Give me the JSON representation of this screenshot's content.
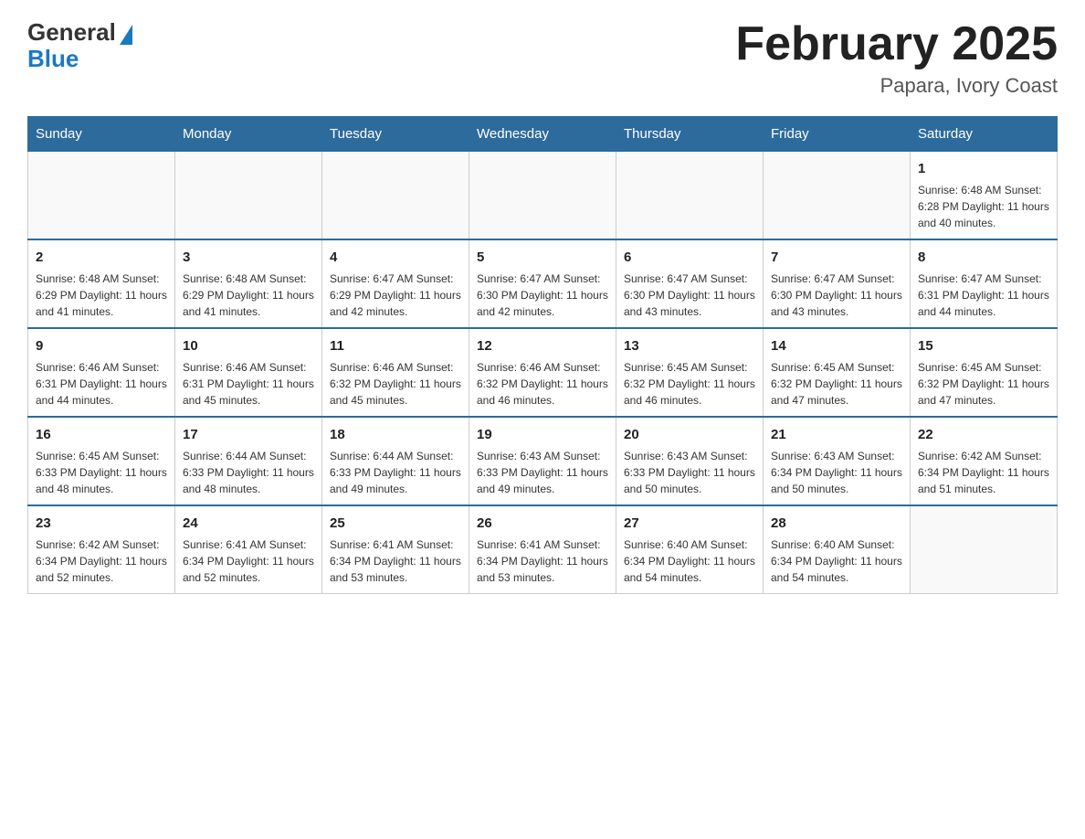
{
  "logo": {
    "general": "General",
    "blue": "Blue"
  },
  "title": "February 2025",
  "subtitle": "Papara, Ivory Coast",
  "days_header": [
    "Sunday",
    "Monday",
    "Tuesday",
    "Wednesday",
    "Thursday",
    "Friday",
    "Saturday"
  ],
  "weeks": [
    [
      {
        "day": "",
        "info": ""
      },
      {
        "day": "",
        "info": ""
      },
      {
        "day": "",
        "info": ""
      },
      {
        "day": "",
        "info": ""
      },
      {
        "day": "",
        "info": ""
      },
      {
        "day": "",
        "info": ""
      },
      {
        "day": "1",
        "info": "Sunrise: 6:48 AM\nSunset: 6:28 PM\nDaylight: 11 hours and 40 minutes."
      }
    ],
    [
      {
        "day": "2",
        "info": "Sunrise: 6:48 AM\nSunset: 6:29 PM\nDaylight: 11 hours and 41 minutes."
      },
      {
        "day": "3",
        "info": "Sunrise: 6:48 AM\nSunset: 6:29 PM\nDaylight: 11 hours and 41 minutes."
      },
      {
        "day": "4",
        "info": "Sunrise: 6:47 AM\nSunset: 6:29 PM\nDaylight: 11 hours and 42 minutes."
      },
      {
        "day": "5",
        "info": "Sunrise: 6:47 AM\nSunset: 6:30 PM\nDaylight: 11 hours and 42 minutes."
      },
      {
        "day": "6",
        "info": "Sunrise: 6:47 AM\nSunset: 6:30 PM\nDaylight: 11 hours and 43 minutes."
      },
      {
        "day": "7",
        "info": "Sunrise: 6:47 AM\nSunset: 6:30 PM\nDaylight: 11 hours and 43 minutes."
      },
      {
        "day": "8",
        "info": "Sunrise: 6:47 AM\nSunset: 6:31 PM\nDaylight: 11 hours and 44 minutes."
      }
    ],
    [
      {
        "day": "9",
        "info": "Sunrise: 6:46 AM\nSunset: 6:31 PM\nDaylight: 11 hours and 44 minutes."
      },
      {
        "day": "10",
        "info": "Sunrise: 6:46 AM\nSunset: 6:31 PM\nDaylight: 11 hours and 45 minutes."
      },
      {
        "day": "11",
        "info": "Sunrise: 6:46 AM\nSunset: 6:32 PM\nDaylight: 11 hours and 45 minutes."
      },
      {
        "day": "12",
        "info": "Sunrise: 6:46 AM\nSunset: 6:32 PM\nDaylight: 11 hours and 46 minutes."
      },
      {
        "day": "13",
        "info": "Sunrise: 6:45 AM\nSunset: 6:32 PM\nDaylight: 11 hours and 46 minutes."
      },
      {
        "day": "14",
        "info": "Sunrise: 6:45 AM\nSunset: 6:32 PM\nDaylight: 11 hours and 47 minutes."
      },
      {
        "day": "15",
        "info": "Sunrise: 6:45 AM\nSunset: 6:32 PM\nDaylight: 11 hours and 47 minutes."
      }
    ],
    [
      {
        "day": "16",
        "info": "Sunrise: 6:45 AM\nSunset: 6:33 PM\nDaylight: 11 hours and 48 minutes."
      },
      {
        "day": "17",
        "info": "Sunrise: 6:44 AM\nSunset: 6:33 PM\nDaylight: 11 hours and 48 minutes."
      },
      {
        "day": "18",
        "info": "Sunrise: 6:44 AM\nSunset: 6:33 PM\nDaylight: 11 hours and 49 minutes."
      },
      {
        "day": "19",
        "info": "Sunrise: 6:43 AM\nSunset: 6:33 PM\nDaylight: 11 hours and 49 minutes."
      },
      {
        "day": "20",
        "info": "Sunrise: 6:43 AM\nSunset: 6:33 PM\nDaylight: 11 hours and 50 minutes."
      },
      {
        "day": "21",
        "info": "Sunrise: 6:43 AM\nSunset: 6:34 PM\nDaylight: 11 hours and 50 minutes."
      },
      {
        "day": "22",
        "info": "Sunrise: 6:42 AM\nSunset: 6:34 PM\nDaylight: 11 hours and 51 minutes."
      }
    ],
    [
      {
        "day": "23",
        "info": "Sunrise: 6:42 AM\nSunset: 6:34 PM\nDaylight: 11 hours and 52 minutes."
      },
      {
        "day": "24",
        "info": "Sunrise: 6:41 AM\nSunset: 6:34 PM\nDaylight: 11 hours and 52 minutes."
      },
      {
        "day": "25",
        "info": "Sunrise: 6:41 AM\nSunset: 6:34 PM\nDaylight: 11 hours and 53 minutes."
      },
      {
        "day": "26",
        "info": "Sunrise: 6:41 AM\nSunset: 6:34 PM\nDaylight: 11 hours and 53 minutes."
      },
      {
        "day": "27",
        "info": "Sunrise: 6:40 AM\nSunset: 6:34 PM\nDaylight: 11 hours and 54 minutes."
      },
      {
        "day": "28",
        "info": "Sunrise: 6:40 AM\nSunset: 6:34 PM\nDaylight: 11 hours and 54 minutes."
      },
      {
        "day": "",
        "info": ""
      }
    ]
  ]
}
